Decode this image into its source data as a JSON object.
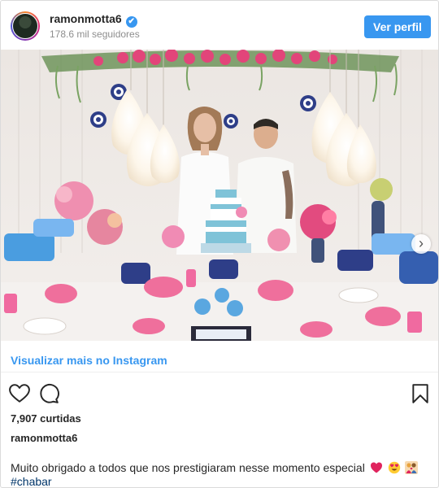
{
  "header": {
    "username": "ramonmotta6",
    "verified_mark": "✔",
    "followers": "178.6 mil seguidores",
    "view_profile_label": "Ver perfil"
  },
  "media": {
    "next_arrow": "›"
  },
  "links": {
    "view_more": "Visualizar mais no Instagram"
  },
  "actions": {
    "like_icon": "heart-icon",
    "comment_icon": "comment-icon",
    "save_icon": "bookmark-icon"
  },
  "post": {
    "likes": "7,907 curtidas",
    "caption_username": "ramonmotta6",
    "caption_text": "Muito obrigado a todos que nos prestigiaram nesse momento especial",
    "hashtag": "#chabar",
    "emojis": [
      "red-heart-emoji",
      "heart-eyes-emoji",
      "couple-emoji"
    ]
  },
  "colors": {
    "accent": "#3897f0",
    "hashtag": "#003569",
    "muted": "#8e8e8e",
    "border": "#dbdbdb"
  }
}
